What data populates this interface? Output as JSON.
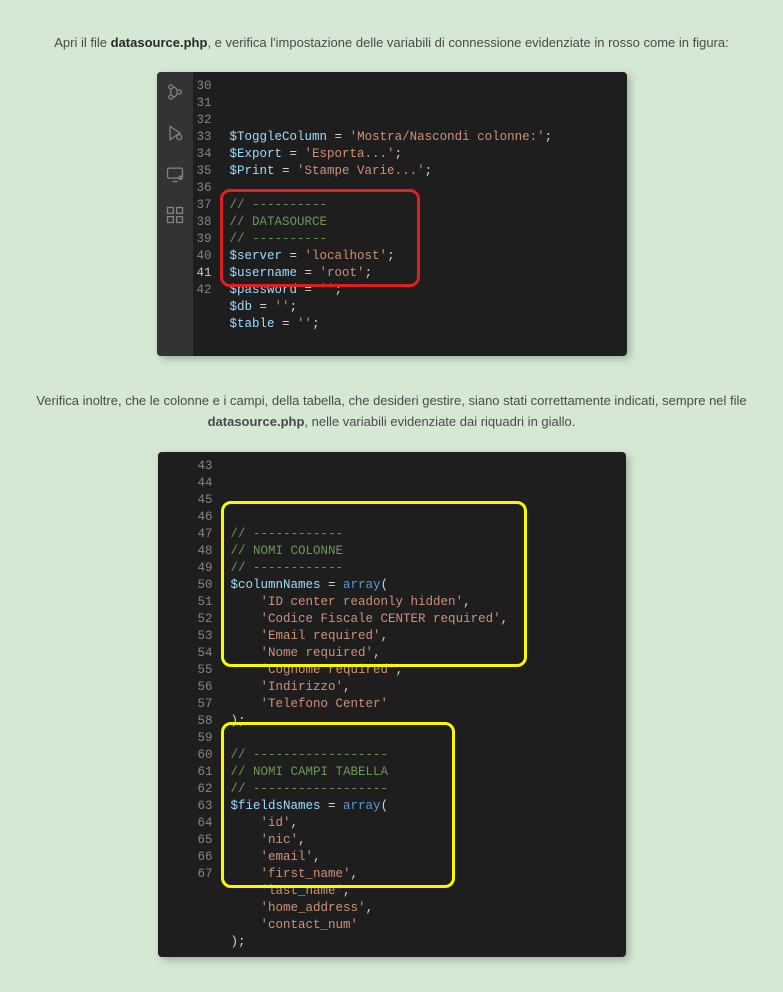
{
  "intro": {
    "prefix": "Apri il file ",
    "filename": "datasource.php",
    "suffix": ", e verifica l'impostazione delle variabili di connessione evidenziate in rosso come in figura:"
  },
  "between": {
    "prefix": "Verifica inoltre, che le colonne e i campi, della tabella, che desideri gestire, siano stati correttamente indicati, sempre nel file ",
    "filename": "datasource.php",
    "suffix": ", nelle variabili evidenziate dai riquadri in giallo."
  },
  "editor1": {
    "lines": [
      {
        "n": "30",
        "t": [
          [
            "var",
            "$ToggleColumn"
          ],
          [
            "op",
            " = "
          ],
          [
            "str",
            "'Mostra/Nascondi colonne:'"
          ],
          [
            "punc",
            ";"
          ]
        ]
      },
      {
        "n": "31",
        "t": [
          [
            "var",
            "$Export"
          ],
          [
            "op",
            " = "
          ],
          [
            "str",
            "'Esporta...'"
          ],
          [
            "punc",
            ";"
          ]
        ]
      },
      {
        "n": "32",
        "t": [
          [
            "var",
            "$Print"
          ],
          [
            "op",
            " = "
          ],
          [
            "str",
            "'Stampe Varie...'"
          ],
          [
            "punc",
            ";"
          ]
        ]
      },
      {
        "n": "33",
        "t": []
      },
      {
        "n": "34",
        "t": [
          [
            "cmt",
            "// ----------"
          ]
        ]
      },
      {
        "n": "35",
        "t": [
          [
            "cmt",
            "// DATASOURCE"
          ]
        ]
      },
      {
        "n": "36",
        "t": [
          [
            "cmt",
            "// ----------"
          ]
        ]
      },
      {
        "n": "37",
        "t": [
          [
            "var",
            "$server"
          ],
          [
            "op",
            " = "
          ],
          [
            "str",
            "'localhost'"
          ],
          [
            "punc",
            ";"
          ]
        ]
      },
      {
        "n": "38",
        "t": [
          [
            "var",
            "$username"
          ],
          [
            "op",
            " = "
          ],
          [
            "str",
            "'root'"
          ],
          [
            "punc",
            ";"
          ]
        ]
      },
      {
        "n": "39",
        "t": [
          [
            "var",
            "$password"
          ],
          [
            "op",
            " = "
          ],
          [
            "str",
            "''"
          ],
          [
            "punc",
            ";"
          ]
        ]
      },
      {
        "n": "40",
        "t": [
          [
            "var",
            "$db"
          ],
          [
            "op",
            " = "
          ],
          [
            "str",
            "''"
          ],
          [
            "punc",
            ";"
          ]
        ]
      },
      {
        "n": "41",
        "current": true,
        "t": [
          [
            "var",
            "$table"
          ],
          [
            "op",
            " = "
          ],
          [
            "str",
            "''"
          ],
          [
            "punc",
            ";"
          ]
        ]
      },
      {
        "n": "42",
        "t": []
      }
    ]
  },
  "editor2": {
    "lines": [
      {
        "n": "43",
        "t": [
          [
            "cmt",
            "// ------------"
          ]
        ]
      },
      {
        "n": "44",
        "t": [
          [
            "cmt",
            "// NOMI COLONNE"
          ]
        ]
      },
      {
        "n": "45",
        "t": [
          [
            "cmt",
            "// ------------"
          ]
        ]
      },
      {
        "n": "46",
        "t": [
          [
            "var",
            "$columnNames"
          ],
          [
            "op",
            " = "
          ],
          [
            "key",
            "array"
          ],
          [
            "punc",
            "("
          ]
        ]
      },
      {
        "n": "47",
        "t": [
          [
            "punc",
            "    "
          ],
          [
            "str",
            "'ID center readonly hidden'"
          ],
          [
            "punc",
            ","
          ]
        ]
      },
      {
        "n": "48",
        "t": [
          [
            "punc",
            "    "
          ],
          [
            "str",
            "'Codice Fiscale CENTER required'"
          ],
          [
            "punc",
            ","
          ]
        ]
      },
      {
        "n": "49",
        "t": [
          [
            "punc",
            "    "
          ],
          [
            "str",
            "'Email required'"
          ],
          [
            "punc",
            ","
          ]
        ]
      },
      {
        "n": "50",
        "t": [
          [
            "punc",
            "    "
          ],
          [
            "str",
            "'Nome required'"
          ],
          [
            "punc",
            ","
          ]
        ]
      },
      {
        "n": "51",
        "t": [
          [
            "punc",
            "    "
          ],
          [
            "str",
            "'Cognome required'"
          ],
          [
            "punc",
            ","
          ]
        ]
      },
      {
        "n": "52",
        "t": [
          [
            "punc",
            "    "
          ],
          [
            "str",
            "'Indirizzo'"
          ],
          [
            "punc",
            ","
          ]
        ]
      },
      {
        "n": "53",
        "t": [
          [
            "punc",
            "    "
          ],
          [
            "str",
            "'Telefono Center'"
          ]
        ]
      },
      {
        "n": "54",
        "t": [
          [
            "punc",
            ");"
          ]
        ]
      },
      {
        "n": "55",
        "t": []
      },
      {
        "n": "56",
        "t": [
          [
            "cmt",
            "// ------------------"
          ]
        ]
      },
      {
        "n": "57",
        "t": [
          [
            "cmt",
            "// NOMI CAMPI TABELLA"
          ]
        ]
      },
      {
        "n": "58",
        "t": [
          [
            "cmt",
            "// ------------------"
          ]
        ]
      },
      {
        "n": "59",
        "t": [
          [
            "var",
            "$fieldsNames"
          ],
          [
            "op",
            " = "
          ],
          [
            "key",
            "array"
          ],
          [
            "punc",
            "("
          ]
        ]
      },
      {
        "n": "60",
        "t": [
          [
            "punc",
            "    "
          ],
          [
            "str",
            "'id'"
          ],
          [
            "punc",
            ","
          ]
        ]
      },
      {
        "n": "61",
        "t": [
          [
            "punc",
            "    "
          ],
          [
            "str",
            "'nic'"
          ],
          [
            "punc",
            ","
          ]
        ]
      },
      {
        "n": "62",
        "t": [
          [
            "punc",
            "    "
          ],
          [
            "str",
            "'email'"
          ],
          [
            "punc",
            ","
          ]
        ]
      },
      {
        "n": "63",
        "t": [
          [
            "punc",
            "    "
          ],
          [
            "str",
            "'first_name'"
          ],
          [
            "punc",
            ","
          ]
        ]
      },
      {
        "n": "64",
        "t": [
          [
            "punc",
            "    "
          ],
          [
            "str",
            "'last_name'"
          ],
          [
            "punc",
            ","
          ]
        ]
      },
      {
        "n": "65",
        "t": [
          [
            "punc",
            "    "
          ],
          [
            "str",
            "'home_address'"
          ],
          [
            "punc",
            ","
          ]
        ]
      },
      {
        "n": "66",
        "t": [
          [
            "punc",
            "    "
          ],
          [
            "str",
            "'contact_num'"
          ]
        ]
      },
      {
        "n": "67",
        "t": [
          [
            "punc",
            ");"
          ]
        ]
      }
    ]
  }
}
